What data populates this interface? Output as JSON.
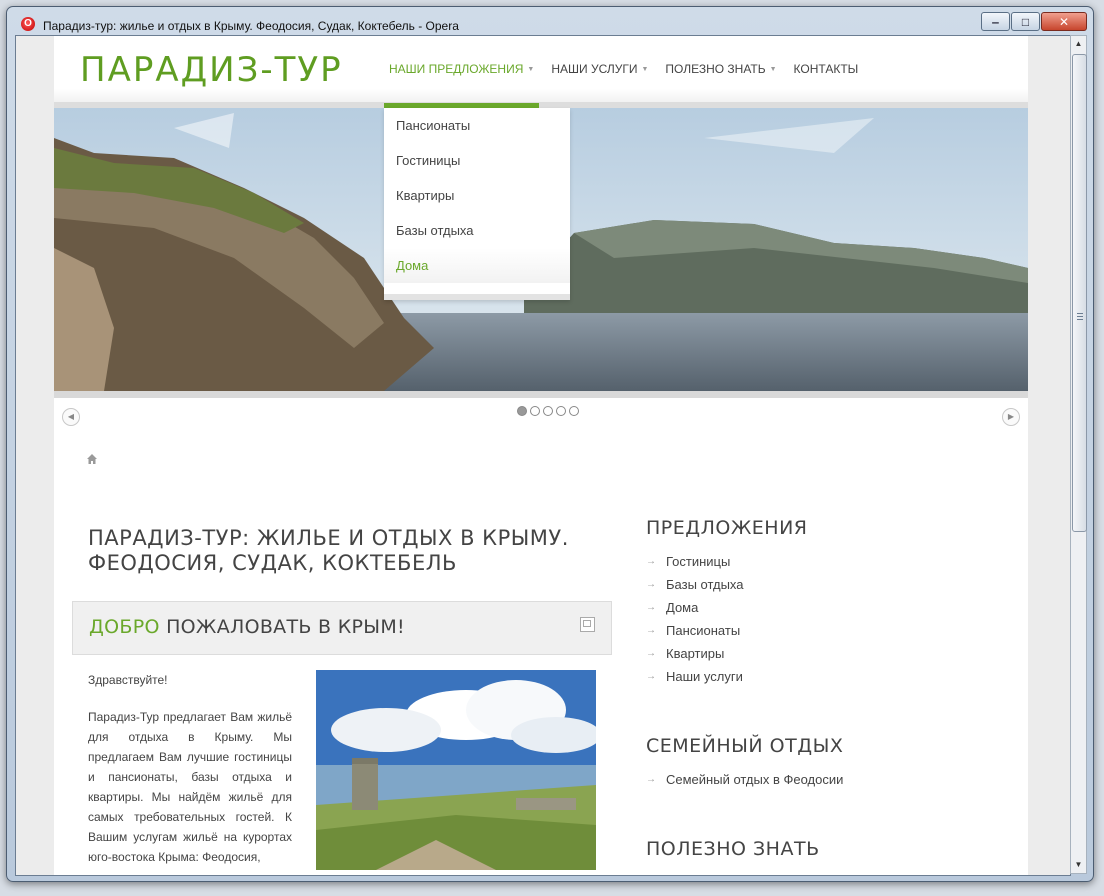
{
  "window": {
    "title": "Парадиз-тур: жилье и отдых в Крыму. Феодосия, Судак, Коктебель - Opera",
    "app_icon": "opera-icon"
  },
  "header": {
    "logo": "ПАРАДИЗ-ТУР",
    "nav": [
      {
        "label": "НАШИ ПРЕДЛОЖЕНИЯ",
        "active": true,
        "has_caret": true
      },
      {
        "label": "НАШИ УСЛУГИ",
        "active": false,
        "has_caret": true
      },
      {
        "label": "ПОЛЕЗНО ЗНАТЬ",
        "active": false,
        "has_caret": true
      },
      {
        "label": "КОНТАКТЫ",
        "active": false,
        "has_caret": false
      }
    ]
  },
  "dropdown": {
    "items": [
      "Пансионаты",
      "Гостиницы",
      "Квартиры",
      "Базы отдыха",
      "Дома"
    ],
    "active_index": 4
  },
  "slider": {
    "slide_count": 5,
    "active_slide": 1
  },
  "content": {
    "title": "ПАРАДИЗ-ТУР: ЖИЛЬЕ И ОТДЫХ В КРЫМУ. ФЕОДОСИЯ, СУДАК, КОКТЕБЕЛЬ",
    "welcome_accent": "ДОБРО",
    "welcome_rest": " ПОЖАЛОВАТЬ В КРЫМ!",
    "paragraphs": [
      "Здравствуйте!",
      "Парадиз-Тур предлагает Вам жильё для отдыха в Крыму. Мы предлагаем Вам лучшие гостиницы и пансионаты, базы отдыха и квартиры. Мы найдём жильё для самых требовательных гостей. К Вашим услугам жильё на курортах юго-востока Крыма: Феодосия,"
    ]
  },
  "sidebar": {
    "sections": [
      {
        "heading": "ПРЕДЛОЖЕНИЯ",
        "items": [
          "Гостиницы",
          "Базы отдыха",
          "Дома",
          "Пансионаты",
          "Квартиры",
          "Наши услуги"
        ]
      },
      {
        "heading": "СЕМЕЙНЫЙ ОТДЫХ",
        "items": [
          "Семейный отдых в Феодосии"
        ]
      },
      {
        "heading": "ПОЛЕЗНО ЗНАТЬ",
        "items": []
      }
    ]
  },
  "colors": {
    "accent": "#6aa82b",
    "logo": "#5f9d21",
    "text": "#444444"
  }
}
